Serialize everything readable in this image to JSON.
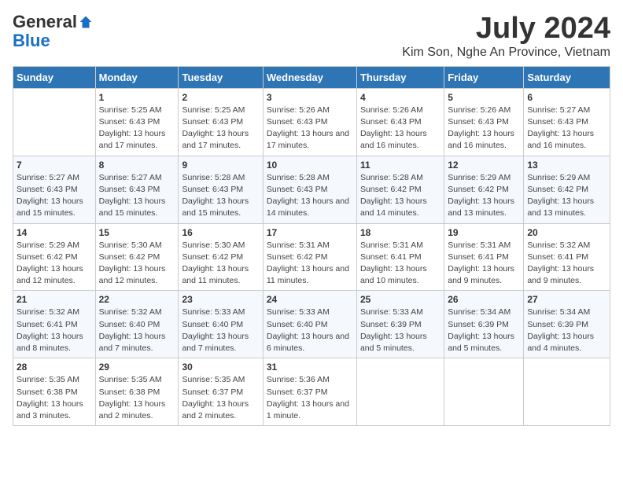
{
  "logo": {
    "general": "General",
    "blue": "Blue"
  },
  "title": {
    "month_year": "July 2024",
    "location": "Kim Son, Nghe An Province, Vietnam"
  },
  "headers": [
    "Sunday",
    "Monday",
    "Tuesday",
    "Wednesday",
    "Thursday",
    "Friday",
    "Saturday"
  ],
  "weeks": [
    [
      {
        "day": "",
        "sunrise": "",
        "sunset": "",
        "daylight": ""
      },
      {
        "day": "1",
        "sunrise": "Sunrise: 5:25 AM",
        "sunset": "Sunset: 6:43 PM",
        "daylight": "Daylight: 13 hours and 17 minutes."
      },
      {
        "day": "2",
        "sunrise": "Sunrise: 5:25 AM",
        "sunset": "Sunset: 6:43 PM",
        "daylight": "Daylight: 13 hours and 17 minutes."
      },
      {
        "day": "3",
        "sunrise": "Sunrise: 5:26 AM",
        "sunset": "Sunset: 6:43 PM",
        "daylight": "Daylight: 13 hours and 17 minutes."
      },
      {
        "day": "4",
        "sunrise": "Sunrise: 5:26 AM",
        "sunset": "Sunset: 6:43 PM",
        "daylight": "Daylight: 13 hours and 16 minutes."
      },
      {
        "day": "5",
        "sunrise": "Sunrise: 5:26 AM",
        "sunset": "Sunset: 6:43 PM",
        "daylight": "Daylight: 13 hours and 16 minutes."
      },
      {
        "day": "6",
        "sunrise": "Sunrise: 5:27 AM",
        "sunset": "Sunset: 6:43 PM",
        "daylight": "Daylight: 13 hours and 16 minutes."
      }
    ],
    [
      {
        "day": "7",
        "sunrise": "Sunrise: 5:27 AM",
        "sunset": "Sunset: 6:43 PM",
        "daylight": "Daylight: 13 hours and 15 minutes."
      },
      {
        "day": "8",
        "sunrise": "Sunrise: 5:27 AM",
        "sunset": "Sunset: 6:43 PM",
        "daylight": "Daylight: 13 hours and 15 minutes."
      },
      {
        "day": "9",
        "sunrise": "Sunrise: 5:28 AM",
        "sunset": "Sunset: 6:43 PM",
        "daylight": "Daylight: 13 hours and 15 minutes."
      },
      {
        "day": "10",
        "sunrise": "Sunrise: 5:28 AM",
        "sunset": "Sunset: 6:43 PM",
        "daylight": "Daylight: 13 hours and 14 minutes."
      },
      {
        "day": "11",
        "sunrise": "Sunrise: 5:28 AM",
        "sunset": "Sunset: 6:42 PM",
        "daylight": "Daylight: 13 hours and 14 minutes."
      },
      {
        "day": "12",
        "sunrise": "Sunrise: 5:29 AM",
        "sunset": "Sunset: 6:42 PM",
        "daylight": "Daylight: 13 hours and 13 minutes."
      },
      {
        "day": "13",
        "sunrise": "Sunrise: 5:29 AM",
        "sunset": "Sunset: 6:42 PM",
        "daylight": "Daylight: 13 hours and 13 minutes."
      }
    ],
    [
      {
        "day": "14",
        "sunrise": "Sunrise: 5:29 AM",
        "sunset": "Sunset: 6:42 PM",
        "daylight": "Daylight: 13 hours and 12 minutes."
      },
      {
        "day": "15",
        "sunrise": "Sunrise: 5:30 AM",
        "sunset": "Sunset: 6:42 PM",
        "daylight": "Daylight: 13 hours and 12 minutes."
      },
      {
        "day": "16",
        "sunrise": "Sunrise: 5:30 AM",
        "sunset": "Sunset: 6:42 PM",
        "daylight": "Daylight: 13 hours and 11 minutes."
      },
      {
        "day": "17",
        "sunrise": "Sunrise: 5:31 AM",
        "sunset": "Sunset: 6:42 PM",
        "daylight": "Daylight: 13 hours and 11 minutes."
      },
      {
        "day": "18",
        "sunrise": "Sunrise: 5:31 AM",
        "sunset": "Sunset: 6:41 PM",
        "daylight": "Daylight: 13 hours and 10 minutes."
      },
      {
        "day": "19",
        "sunrise": "Sunrise: 5:31 AM",
        "sunset": "Sunset: 6:41 PM",
        "daylight": "Daylight: 13 hours and 9 minutes."
      },
      {
        "day": "20",
        "sunrise": "Sunrise: 5:32 AM",
        "sunset": "Sunset: 6:41 PM",
        "daylight": "Daylight: 13 hours and 9 minutes."
      }
    ],
    [
      {
        "day": "21",
        "sunrise": "Sunrise: 5:32 AM",
        "sunset": "Sunset: 6:41 PM",
        "daylight": "Daylight: 13 hours and 8 minutes."
      },
      {
        "day": "22",
        "sunrise": "Sunrise: 5:32 AM",
        "sunset": "Sunset: 6:40 PM",
        "daylight": "Daylight: 13 hours and 7 minutes."
      },
      {
        "day": "23",
        "sunrise": "Sunrise: 5:33 AM",
        "sunset": "Sunset: 6:40 PM",
        "daylight": "Daylight: 13 hours and 7 minutes."
      },
      {
        "day": "24",
        "sunrise": "Sunrise: 5:33 AM",
        "sunset": "Sunset: 6:40 PM",
        "daylight": "Daylight: 13 hours and 6 minutes."
      },
      {
        "day": "25",
        "sunrise": "Sunrise: 5:33 AM",
        "sunset": "Sunset: 6:39 PM",
        "daylight": "Daylight: 13 hours and 5 minutes."
      },
      {
        "day": "26",
        "sunrise": "Sunrise: 5:34 AM",
        "sunset": "Sunset: 6:39 PM",
        "daylight": "Daylight: 13 hours and 5 minutes."
      },
      {
        "day": "27",
        "sunrise": "Sunrise: 5:34 AM",
        "sunset": "Sunset: 6:39 PM",
        "daylight": "Daylight: 13 hours and 4 minutes."
      }
    ],
    [
      {
        "day": "28",
        "sunrise": "Sunrise: 5:35 AM",
        "sunset": "Sunset: 6:38 PM",
        "daylight": "Daylight: 13 hours and 3 minutes."
      },
      {
        "day": "29",
        "sunrise": "Sunrise: 5:35 AM",
        "sunset": "Sunset: 6:38 PM",
        "daylight": "Daylight: 13 hours and 2 minutes."
      },
      {
        "day": "30",
        "sunrise": "Sunrise: 5:35 AM",
        "sunset": "Sunset: 6:37 PM",
        "daylight": "Daylight: 13 hours and 2 minutes."
      },
      {
        "day": "31",
        "sunrise": "Sunrise: 5:36 AM",
        "sunset": "Sunset: 6:37 PM",
        "daylight": "Daylight: 13 hours and 1 minute."
      },
      {
        "day": "",
        "sunrise": "",
        "sunset": "",
        "daylight": ""
      },
      {
        "day": "",
        "sunrise": "",
        "sunset": "",
        "daylight": ""
      },
      {
        "day": "",
        "sunrise": "",
        "sunset": "",
        "daylight": ""
      }
    ]
  ]
}
